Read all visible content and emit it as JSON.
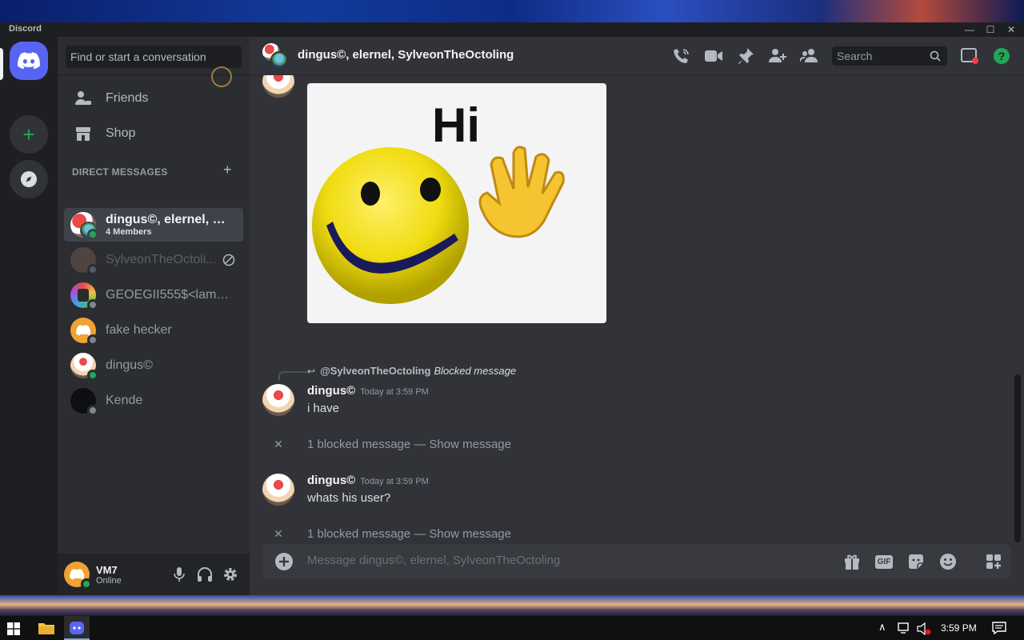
{
  "window": {
    "title": "Discord"
  },
  "sidebar": {
    "search_placeholder": "Find or start a conversation",
    "nav": [
      {
        "label": "Friends",
        "icon": "friends-icon"
      },
      {
        "label": "Shop",
        "icon": "shop-icon"
      }
    ],
    "dm_header": "DIRECT MESSAGES",
    "dms": [
      {
        "name": "dingus©, elernel, Sylv...",
        "sub": "4 Members",
        "status": "online",
        "active": true
      },
      {
        "name": "SylveonTheOctoli...",
        "status": "offline",
        "blocked": true
      },
      {
        "name": "GEOEGII555$<lambd...",
        "status": "offline"
      },
      {
        "name": "fake hecker",
        "status": "offline"
      },
      {
        "name": "dingus©",
        "status": "online"
      },
      {
        "name": "Kende",
        "status": "offline"
      }
    ]
  },
  "user": {
    "name": "VM7",
    "status": "Online"
  },
  "chat": {
    "title": "dingus©, elernel, SylveonTheOctoling",
    "search_placeholder": "Search",
    "image_text": "Hi",
    "reply": {
      "name": "@SylveonTheOctoling",
      "text": "Blocked message"
    },
    "messages": [
      {
        "author": "dingus©",
        "time": "Today at 3:59 PM",
        "text": "i have"
      },
      {
        "author": "dingus©",
        "time": "Today at 3:59 PM",
        "text": "whats his user?"
      }
    ],
    "blocked": {
      "text": "1 blocked message —",
      "link": "Show message"
    },
    "composer_placeholder": "Message dingus©, elernel, SylveonTheOctoling",
    "composer_gif": "GIF"
  },
  "taskbar": {
    "time": "3:59 PM"
  }
}
